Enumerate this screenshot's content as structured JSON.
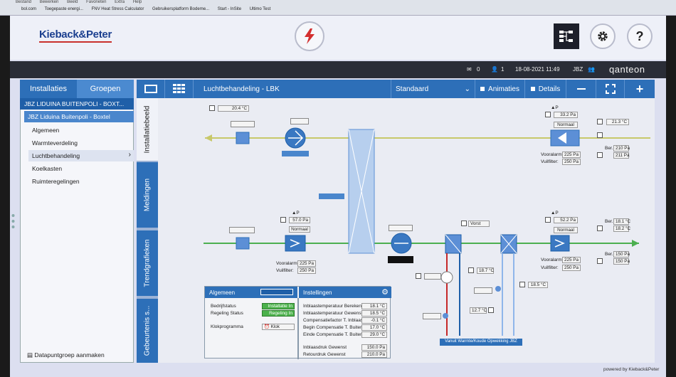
{
  "browser": {
    "menu": [
      "Bestand",
      "Bewerken",
      "Beeld",
      "Favorieten",
      "Extra",
      "Help"
    ],
    "favorites": [
      "bol.com",
      "Toegepaste energi...",
      "FNV Heat Stress Calculator",
      "Gebruikersplatform Bodeme...",
      "Start - InSite",
      "Ultimo Test"
    ]
  },
  "header": {
    "logo": "Kieback&Peter",
    "help_glyph": "?"
  },
  "statusbar": {
    "mail_count": "0",
    "user_count": "1",
    "datetime": "18-08-2021 11:49",
    "site_code": "JBZ",
    "brand": "qanteon"
  },
  "sidebar": {
    "tab_installaties": "Installaties",
    "tab_groepen": "Groepen",
    "site": "JBZ LIDUINA BUITENPOLI - BOXT...",
    "sub": "JBZ Liduina Buitenpoli - Boxtel",
    "items": [
      "Algemeen",
      "Warmteverdeling",
      "Luchtbehandeling",
      "Koelkasten",
      "Ruimteregelingen"
    ],
    "bottom": "Datapuntgroep aanmaken"
  },
  "vtabs": [
    "Installatiebeeld",
    "Meldingen",
    "Trendgrafieken",
    "Gebeurtenis s..."
  ],
  "toolbar": {
    "title": "Luchtbehandeling - LBK",
    "view": "Standaard",
    "animaties": "Animaties",
    "details": "Details"
  },
  "scheme": {
    "top_temp": "20.4 °C",
    "top_dp_label": "▲P",
    "top_dp_value": "33.2 Pa",
    "top_dp_status": "Normaal",
    "top_right_temp": "21.3 °C",
    "top_voor_label": "Vooralarm:",
    "top_voor_val": "225 Pa",
    "top_vuil_label": "Vuilfilter:",
    "top_vuil_val": "250 Pa",
    "top_ber_label": "Ber.",
    "top_ber_val": "210 Pa",
    "top_ber2_val": "211 Pa",
    "mid_dp_label": "▲P",
    "mid_dp_value": "57.0 Pa",
    "mid_dp_status": "Normaal",
    "mid_voor_label": "Vooralarm:",
    "mid_voor_val": "225 Pa",
    "mid_vuil_label": "Vuilfilter:",
    "mid_vuil_val": "250 Pa",
    "vorst": "Vorst",
    "right_dp_label": "▲P",
    "right_dp_value": "52.2 Pa",
    "right_dp_status": "Normaal",
    "right_ber_label": "Ber.",
    "right_ber_val": "18.1 °C",
    "right_ber_val2": "18.2 °C",
    "right_ber2_label": "Ber.",
    "right_ber2_val": "150 Pa",
    "right_ber2_val2": "150 Pa",
    "right_voor_label": "Vooralarm:",
    "right_voor_val": "225 Pa",
    "right_vuil_label": "Vuilfilter:",
    "right_vuil_val": "250 Pa",
    "coil_temp1": "18.7 °C",
    "coil_temp2": "12.7 °C",
    "coil_temp3": "18.5 °C",
    "supply_label": "Vanuit Warmte/Koude Opwekking JBZ"
  },
  "panel_algemeen": {
    "title": "Algemeen",
    "rows": [
      {
        "label": "Bedrijfstatus",
        "value": "Installatie In"
      },
      {
        "label": "Regeling Status",
        "value": "Regeling In"
      },
      {
        "label": "Klokprogramma",
        "value": "Klok"
      }
    ]
  },
  "panel_instellingen": {
    "title": "Instellingen",
    "rows": [
      {
        "label": "Inblaastemperatuur Berekend",
        "value": "18.1 °C"
      },
      {
        "label": "Inblaastemperatuur Gewenst",
        "value": "18.5 °C"
      },
      {
        "label": "Compensatiefactor T. Inblaas",
        "value": "-0.1 °C"
      },
      {
        "label": "Begin Compensatie T. Buiten",
        "value": "17.0 °C"
      },
      {
        "label": "Einde Compensatie T. Buiten",
        "value": "29.0 °C"
      },
      {
        "label": "Inblaasdruk Gewenst",
        "value": "150.0 Pa"
      },
      {
        "label": "Retourdruk Gewenst",
        "value": "210.0 Pa"
      }
    ]
  },
  "footer": "powered by Kieback&Peter",
  "colors": {
    "accent": "#2d6fb8",
    "exhaust_duct": "#c8c86a",
    "supply_duct": "#4caf50",
    "hot": "#c62828",
    "cold": "#5c8fd6"
  }
}
